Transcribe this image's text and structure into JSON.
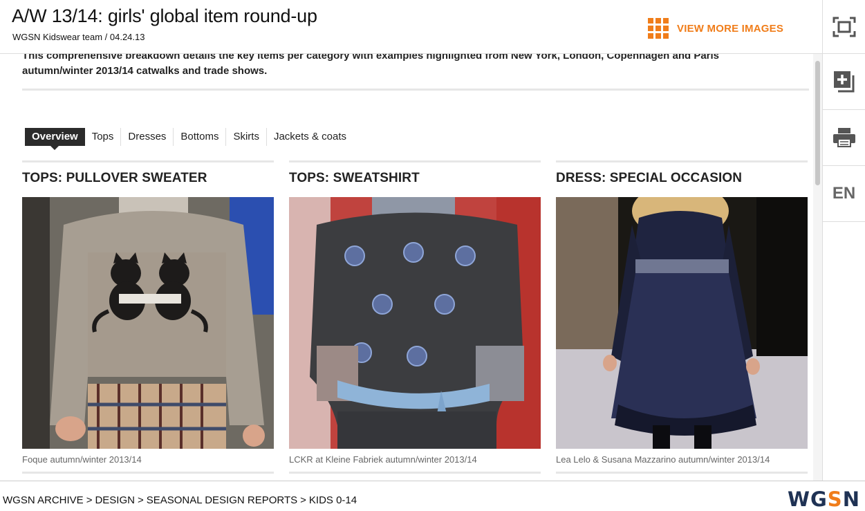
{
  "header": {
    "title": "A/W 13/14: girls' global item round-up",
    "byline": "WGSN Kidswear team / 04.24.13",
    "view_more_label": "VIEW MORE IMAGES"
  },
  "toolbar": {
    "language": "EN"
  },
  "intro": {
    "text": "This comprehensive breakdown details the key items per category with examples highlighted from New York, London, Copenhagen and Paris autumn/winter 2013/14 catwalks and trade shows."
  },
  "tabs": [
    {
      "label": "Overview",
      "active": true
    },
    {
      "label": "Tops",
      "active": false
    },
    {
      "label": "Dresses",
      "active": false
    },
    {
      "label": "Bottoms",
      "active": false
    },
    {
      "label": "Skirts",
      "active": false
    },
    {
      "label": "Jackets & coats",
      "active": false
    }
  ],
  "cards": [
    {
      "title": "TOPS: PULLOVER SWEATER",
      "caption": "Foque autumn/winter 2013/14"
    },
    {
      "title": "TOPS: SWEATSHIRT",
      "caption": "LCKR at Kleine Fabriek autumn/winter 2013/14"
    },
    {
      "title": "DRESS: SPECIAL OCCASION",
      "caption": "Lea Lelo & Susana Mazzarino autumn/winter 2013/14"
    }
  ],
  "footer": {
    "breadcrumb": [
      "WGSN ARCHIVE",
      "DESIGN",
      "SEASONAL DESIGN REPORTS",
      "KIDS 0-14"
    ],
    "separator": ">",
    "logo_prefix": "WG",
    "logo_accent": "S",
    "logo_suffix": "N"
  },
  "colors": {
    "accent": "#f07d1a",
    "logo_navy": "#1f3254",
    "active_tab": "#2b2b2b"
  },
  "icons": {
    "view_more": "grid-icon",
    "fullscreen": "fullscreen-icon",
    "add": "add-to-board-icon",
    "print": "print-icon"
  }
}
